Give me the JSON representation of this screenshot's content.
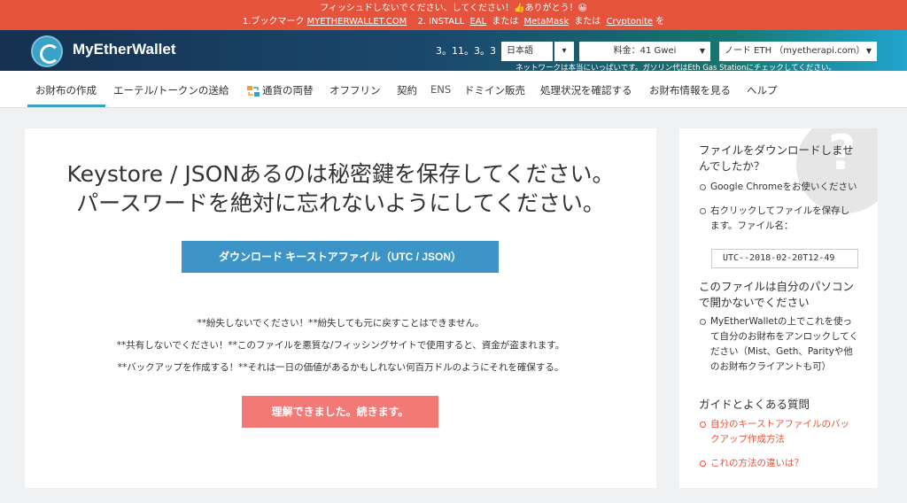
{
  "banner": {
    "line1": "フィッシュドしないでください、してください！👍ありがとう！😀",
    "item1_prefix": "1.ブックマーク",
    "item1_link": "MYETHERWALLET.COM",
    "item2_prefix": "2. INSTALL ",
    "item2_link1": "EAL",
    "item2_mid1": " または ",
    "item2_link2": "MetaMask",
    "item2_mid2": " または ",
    "item2_link3": "Cryptonite",
    "item2_suffix": "を"
  },
  "header": {
    "brand": "MyEtherWallet",
    "version": "3。11。3。3",
    "language": "日本語",
    "fee_label": "料金：41 Gwei",
    "node_label": "ノード ETH （myetherapi.com）",
    "network_message": "ネットワークは本当にいっぱいです。ガソリン代はEth Gas Stationにチェックしてください。"
  },
  "nav": {
    "items": [
      "お財布の作成",
      "エーテル/トークンの送給",
      "通貨の両替",
      "オフフリン",
      "契約",
      "ENS",
      "ドミイン販売",
      "処理状況を確認する",
      "お財布情報を見る",
      "ヘルプ"
    ]
  },
  "main": {
    "title_line1": "Keystore / JSONあるのは秘密鍵を保存してください。",
    "title_line2": "パースワードを絶対に忘れないようにしてください。",
    "download_button": "ダウンロード キーストアファイル（UTC / JSON）",
    "warning1": "**紛失しないでください！**紛失しても元に戻すことはできません。",
    "warning2": "**共有しないでください！**このファイルを悪質な/フィッシングサイトで使用すると、資金が盗まれます。",
    "warning3": "**バックアップを作成する！**それは一日の価値があるかもしれない何百万ドルのようにそれを確保する。",
    "continue_button": "理解できました。続きます。"
  },
  "sidebar": {
    "qmark": "?",
    "heading1": "ファイルをダウンロードしませんでしたか？",
    "tip1": "Google Chromeをお使いください",
    "tip2": "右クリックしてファイルを保存します。ファイル名：",
    "filename": "UTC--2018-02-20T12-49",
    "heading2": "このファイルは自分のパソコンで開かないでください",
    "tip3": "MyEtherWalletの上でこれを使って自分のお財布をアンロックしてください（Mist、Geth、Parityや他のお財布クライアントも可）",
    "heading3": "ガイドとよくある質問",
    "link1": "自分のキーストアファイルのバックアップ作成方法",
    "link2": "これの方法の違いは？"
  },
  "colors": {
    "banner": "#e6533d",
    "accent": "#3d94c6",
    "confirm": "#f27976",
    "link": "#e6533d"
  }
}
